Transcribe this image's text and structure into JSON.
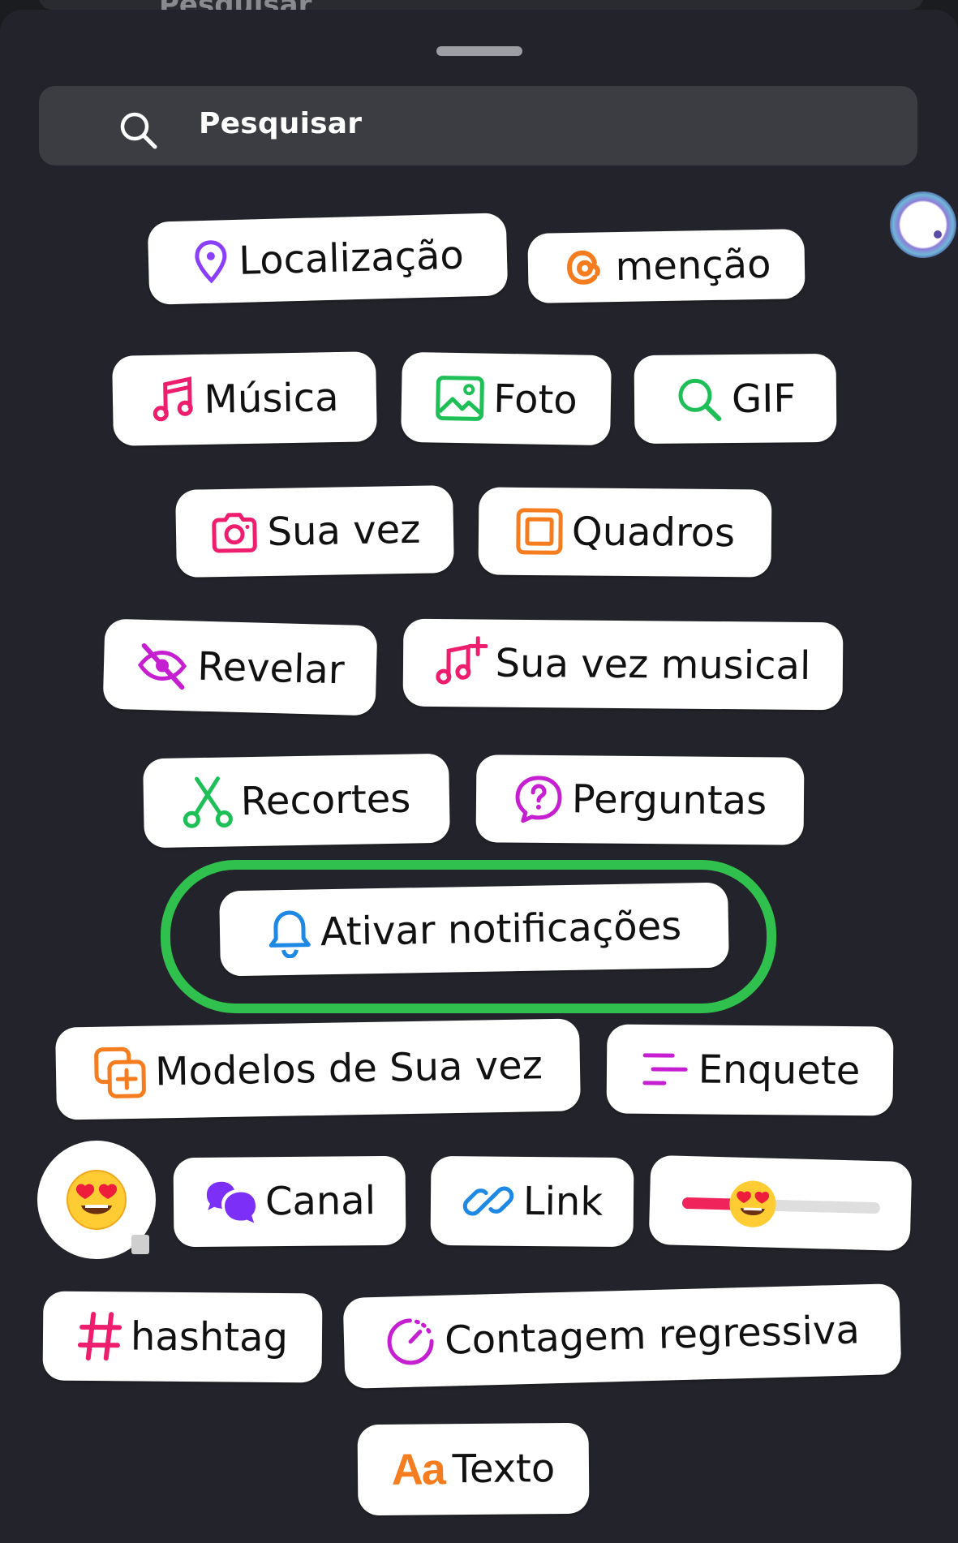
{
  "background": {
    "search_placeholder_peek": "Pesquisar"
  },
  "search": {
    "placeholder": "Pesquisar"
  },
  "stickers": {
    "localizacao": "Localização",
    "mencao": "menção",
    "musica": "Música",
    "foto": "Foto",
    "gif": "GIF",
    "sua_vez": "Sua vez",
    "quadros": "Quadros",
    "revelar": "Revelar",
    "sua_vez_musical": "Sua vez musical",
    "recortes": "Recortes",
    "perguntas": "Perguntas",
    "ativar_notificacoes": "Ativar notificações",
    "modelos_de_sua_vez": "Modelos de Sua vez",
    "enquete": "Enquete",
    "canal": "Canal",
    "link": "Link",
    "hashtag": "hashtag",
    "contagem_regressiva": "Contagem regressiva",
    "texto": "Texto",
    "texto_icon_glyph": "Aa"
  },
  "emoji_slider": {
    "value_fraction": 0.25
  },
  "highlighted_sticker": "Ativar notificações",
  "colors": {
    "sheet_background": "#23242b",
    "search_background": "#3c3d43",
    "highlight_ring": "#2fc04e",
    "location_icon": "#8a3ffc",
    "threads_icon": "#f57c1f",
    "pink_icon": "#ee1d6d",
    "green_icon": "#1fbf57",
    "orange_icon": "#f57c1f",
    "magenta_icon": "#c51fd1",
    "blue_icon": "#1e88e5",
    "purple_icon": "#7b2ff7",
    "slider_fill": "#f0245a"
  },
  "icons": {
    "location": "map-pin-icon",
    "mention": "threads-at-icon",
    "music": "music-note-icon",
    "photo": "image-icon",
    "gif": "search-icon",
    "add_yours": "camera-icon",
    "frames": "frame-icon",
    "reveal": "eye-off-icon",
    "music_add_yours": "music-plus-icon",
    "cutouts": "scissors-icon",
    "questions": "question-bubble-icon",
    "notify": "bell-icon",
    "templates": "add-copy-icon",
    "poll": "poll-icon",
    "emoji": "heart-eyes-emoji-icon",
    "channel": "chat-bubbles-icon",
    "link": "link-icon",
    "hashtag": "hash-icon",
    "countdown": "timer-icon",
    "text": "text-aa-icon"
  }
}
